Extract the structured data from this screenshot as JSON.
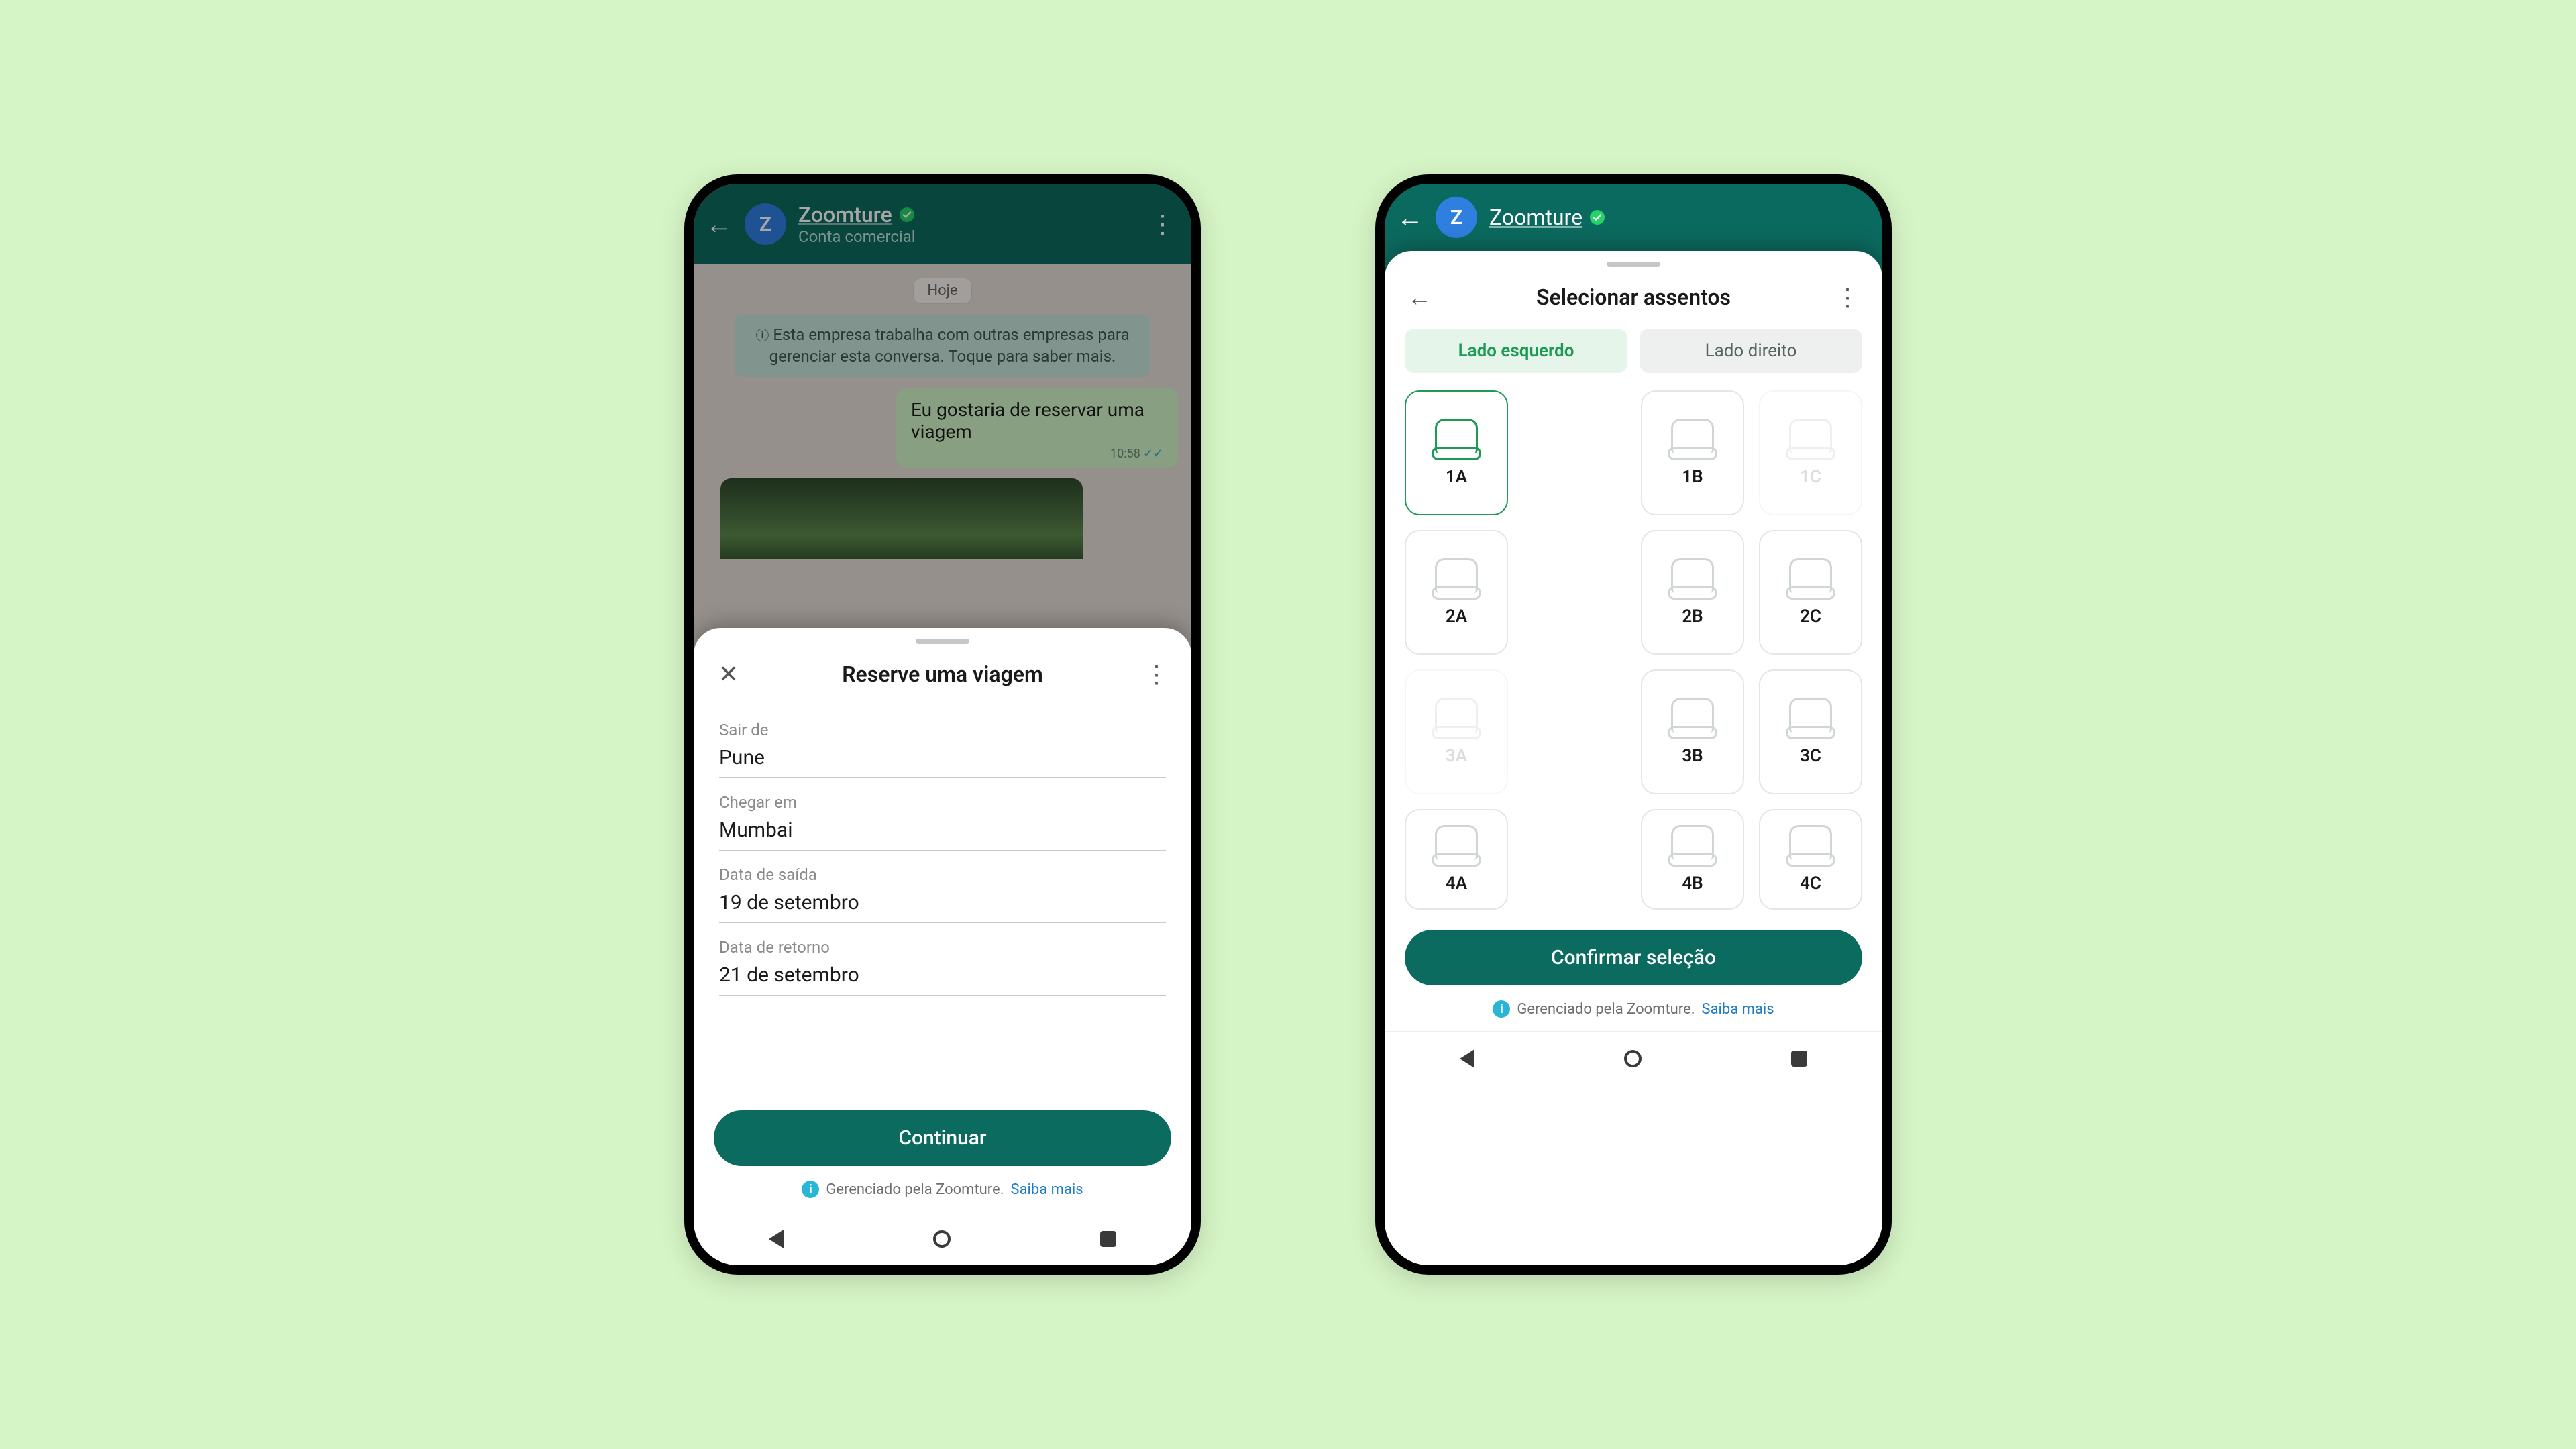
{
  "phone1": {
    "header": {
      "business_name": "Zoomture",
      "subtitle": "Conta comercial"
    },
    "chat": {
      "date_chip": "Hoje",
      "system_message": "Esta empresa trabalha com outras empresas para gerenciar esta conversa. Toque para saber mais.",
      "user_message": "Eu gostaria de reservar uma viagem",
      "user_message_time": "10:58"
    },
    "sheet": {
      "title": "Reserve uma viagem",
      "fields": {
        "depart_label": "Sair de",
        "depart_value": "Pune",
        "arrive_label": "Chegar em",
        "arrive_value": "Mumbai",
        "date_out_label": "Data de saída",
        "date_out_value": "19 de setembro",
        "date_return_label": "Data de retorno",
        "date_return_value": "21 de setembro"
      },
      "cta": "Continuar",
      "managed_text": "Gerenciado pela Zoomture.",
      "managed_link": "Saiba mais"
    }
  },
  "phone2": {
    "header": {
      "business_name": "Zoomture"
    },
    "sheet": {
      "title": "Selecionar assentos",
      "tabs": {
        "left": "Lado esquerdo",
        "right": "Lado direito"
      },
      "seats": [
        {
          "label": "1A",
          "state": "selected"
        },
        {
          "label": "",
          "state": "blank"
        },
        {
          "label": "1B",
          "state": "available"
        },
        {
          "label": "1C",
          "state": "disabled"
        },
        {
          "label": "2A",
          "state": "available"
        },
        {
          "label": "",
          "state": "blank"
        },
        {
          "label": "2B",
          "state": "available"
        },
        {
          "label": "2C",
          "state": "available"
        },
        {
          "label": "3A",
          "state": "disabled"
        },
        {
          "label": "",
          "state": "blank"
        },
        {
          "label": "3B",
          "state": "available"
        },
        {
          "label": "3C",
          "state": "available"
        },
        {
          "label": "4A",
          "state": "available"
        },
        {
          "label": "",
          "state": "blank"
        },
        {
          "label": "4B",
          "state": "available"
        },
        {
          "label": "4C",
          "state": "available"
        }
      ],
      "cta": "Confirmar seleção",
      "managed_text": "Gerenciado pela Zoomture.",
      "managed_link": "Saiba mais"
    }
  }
}
